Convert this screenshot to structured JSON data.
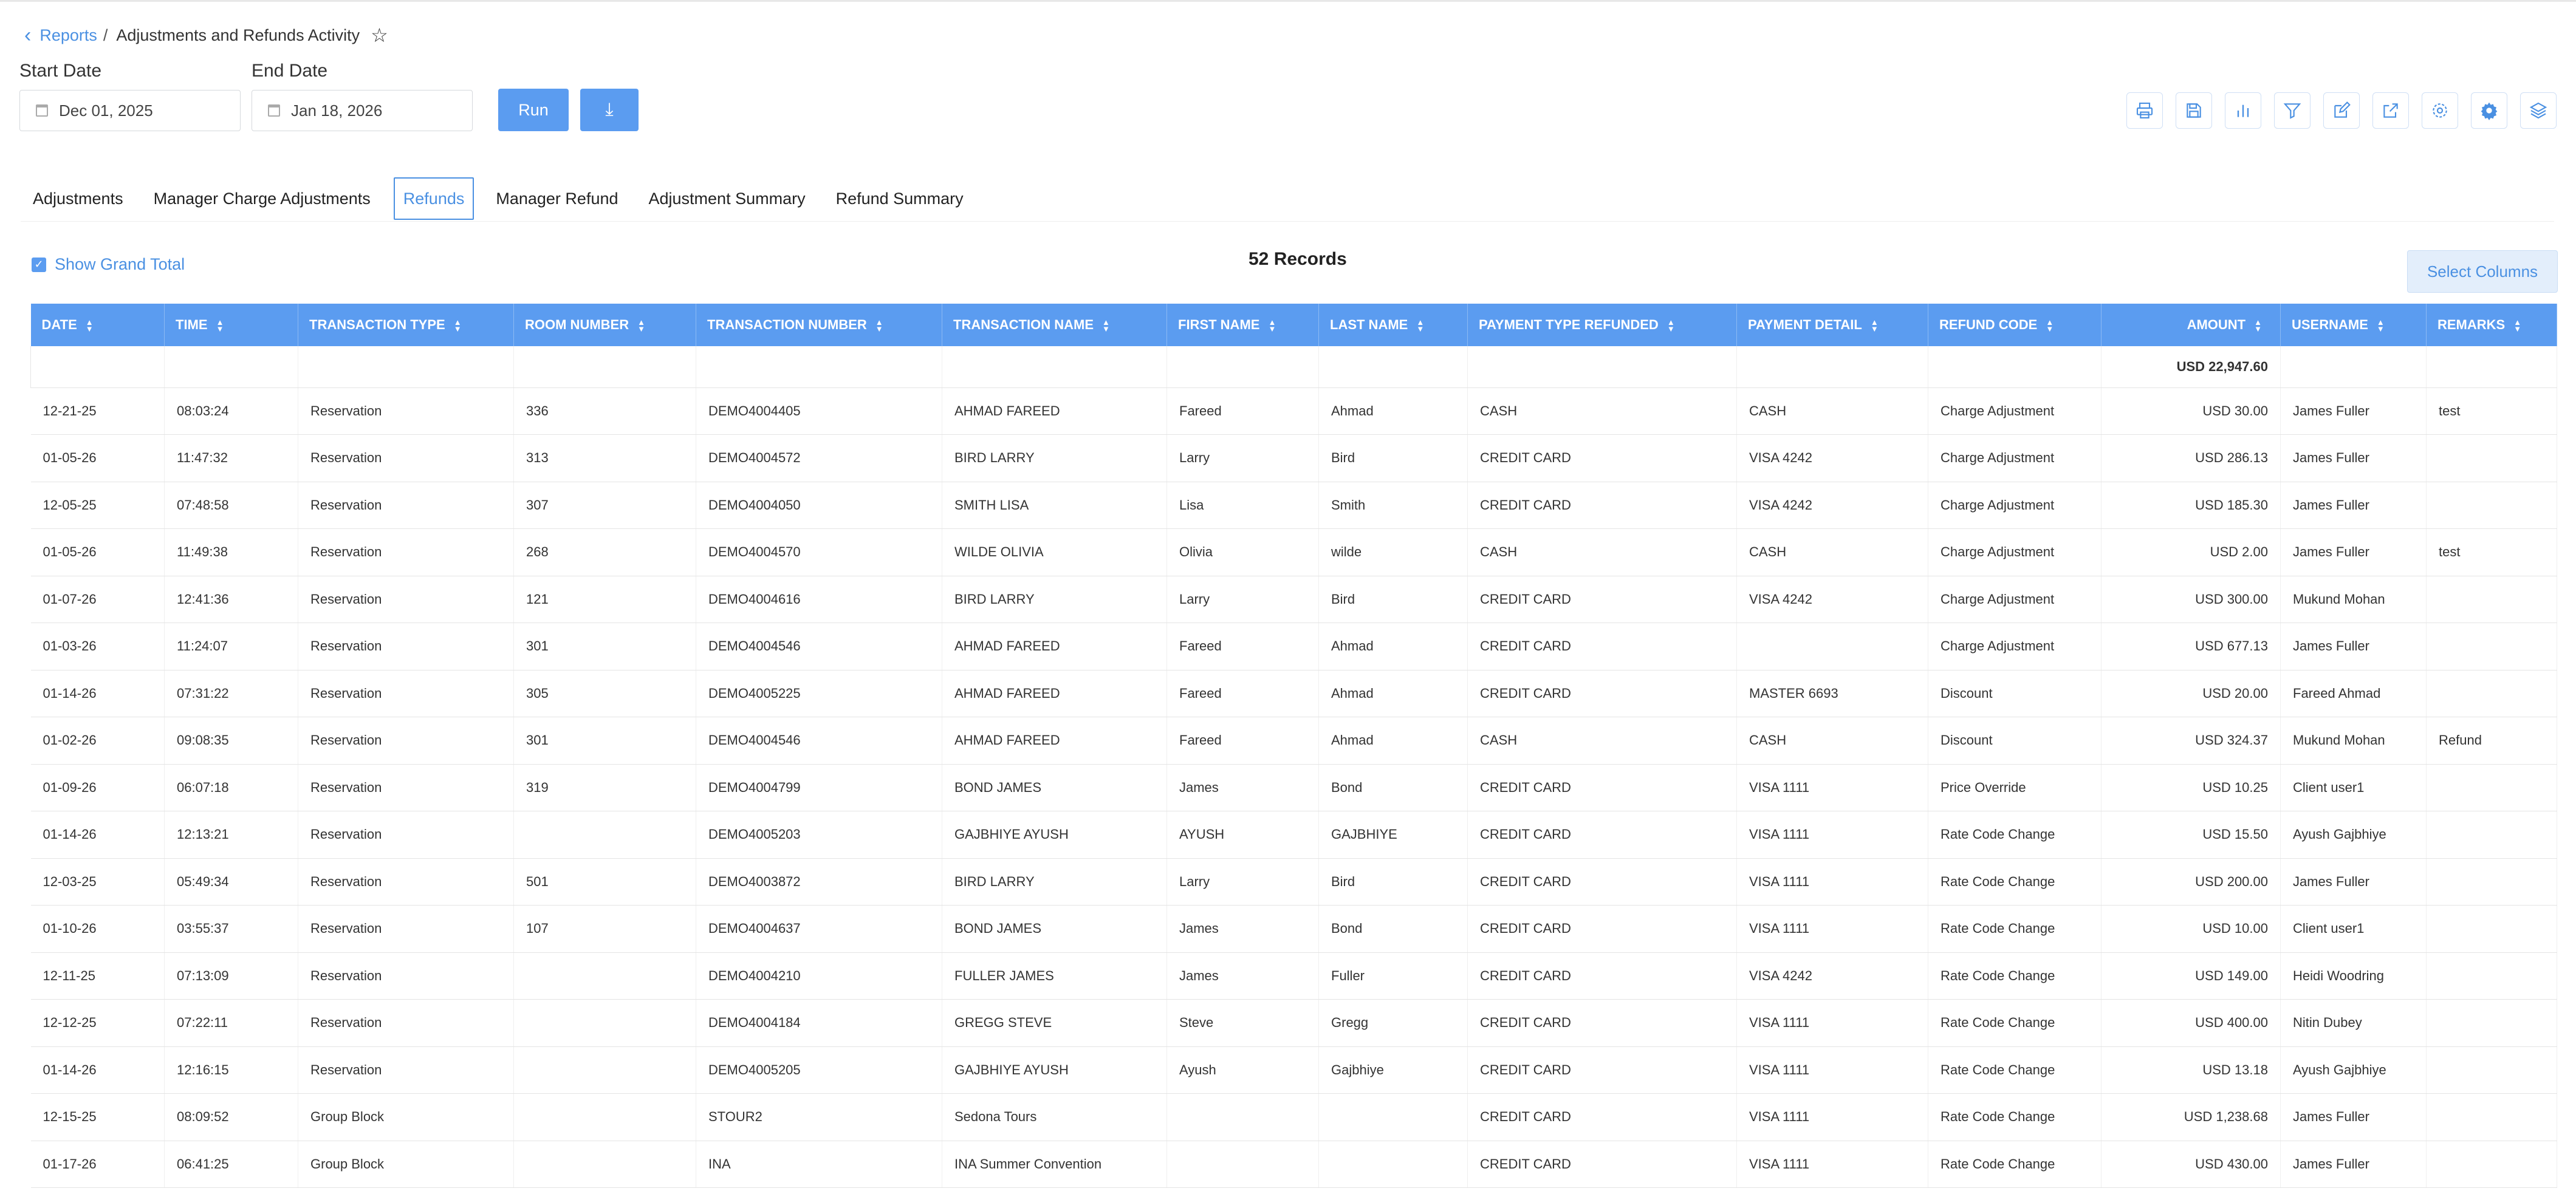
{
  "breadcrumb": {
    "parent": "Reports",
    "separator": "/",
    "current": "Adjustments and Refunds Activity"
  },
  "filters": {
    "start_label": "Start Date",
    "start_value": "Dec 01, 2025",
    "end_label": "End Date",
    "end_value": "Jan 18, 2026",
    "run_label": "Run"
  },
  "toolbar_icons": [
    "print-icon",
    "save-icon",
    "chart-icon",
    "filter-icon",
    "edit-icon",
    "export-icon",
    "settings-icon",
    "settings-alt-icon",
    "layers-icon"
  ],
  "tabs": [
    {
      "label": "Adjustments",
      "active": false
    },
    {
      "label": "Manager Charge Adjustments",
      "active": false
    },
    {
      "label": "Refunds",
      "active": true
    },
    {
      "label": "Manager Refund",
      "active": false
    },
    {
      "label": "Adjustment Summary",
      "active": false
    },
    {
      "label": "Refund Summary",
      "active": false
    }
  ],
  "show_grand_total_label": "Show Grand Total",
  "records_label": "52 Records",
  "select_columns_label": "Select Columns",
  "colors": {
    "accent": "#4a90e2",
    "header_bg": "#5b9cf0"
  },
  "table": {
    "columns": [
      "DATE",
      "TIME",
      "TRANSACTION TYPE",
      "ROOM NUMBER",
      "TRANSACTION NUMBER",
      "TRANSACTION NAME",
      "FIRST NAME",
      "LAST NAME",
      "PAYMENT TYPE REFUNDED",
      "PAYMENT DETAIL",
      "REFUND CODE",
      "AMOUNT",
      "USERNAME",
      "REMARKS"
    ],
    "grand_total": "USD 22,947.60",
    "rows": [
      [
        "12-21-25",
        "08:03:24",
        "Reservation",
        "336",
        "DEMO4004405",
        "AHMAD FAREED",
        "Fareed",
        "Ahmad",
        "CASH",
        "CASH",
        "Charge Adjustment",
        "USD 30.00",
        "James Fuller",
        "test"
      ],
      [
        "01-05-26",
        "11:47:32",
        "Reservation",
        "313",
        "DEMO4004572",
        "BIRD LARRY",
        "Larry",
        "Bird",
        "CREDIT CARD",
        "VISA 4242",
        "Charge Adjustment",
        "USD 286.13",
        "James Fuller",
        ""
      ],
      [
        "12-05-25",
        "07:48:58",
        "Reservation",
        "307",
        "DEMO4004050",
        "SMITH LISA",
        "Lisa",
        "Smith",
        "CREDIT CARD",
        "VISA 4242",
        "Charge Adjustment",
        "USD 185.30",
        "James Fuller",
        ""
      ],
      [
        "01-05-26",
        "11:49:38",
        "Reservation",
        "268",
        "DEMO4004570",
        "WILDE OLIVIA",
        "Olivia",
        "wilde",
        "CASH",
        "CASH",
        "Charge Adjustment",
        "USD 2.00",
        "James Fuller",
        "test"
      ],
      [
        "01-07-26",
        "12:41:36",
        "Reservation",
        "121",
        "DEMO4004616",
        "BIRD LARRY",
        "Larry",
        "Bird",
        "CREDIT CARD",
        "VISA 4242",
        "Charge Adjustment",
        "USD 300.00",
        "Mukund Mohan",
        ""
      ],
      [
        "01-03-26",
        "11:24:07",
        "Reservation",
        "301",
        "DEMO4004546",
        "AHMAD FAREED",
        "Fareed",
        "Ahmad",
        "CREDIT CARD",
        "",
        "Charge Adjustment",
        "USD 677.13",
        "James Fuller",
        ""
      ],
      [
        "01-14-26",
        "07:31:22",
        "Reservation",
        "305",
        "DEMO4005225",
        "AHMAD FAREED",
        "Fareed",
        "Ahmad",
        "CREDIT CARD",
        "MASTER 6693",
        "Discount",
        "USD 20.00",
        "Fareed Ahmad",
        ""
      ],
      [
        "01-02-26",
        "09:08:35",
        "Reservation",
        "301",
        "DEMO4004546",
        "AHMAD FAREED",
        "Fareed",
        "Ahmad",
        "CASH",
        "CASH",
        "Discount",
        "USD 324.37",
        "Mukund Mohan",
        "Refund"
      ],
      [
        "01-09-26",
        "06:07:18",
        "Reservation",
        "319",
        "DEMO4004799",
        "BOND JAMES",
        "James",
        "Bond",
        "CREDIT CARD",
        "VISA 1111",
        "Price Override",
        "USD 10.25",
        "Client user1",
        ""
      ],
      [
        "01-14-26",
        "12:13:21",
        "Reservation",
        "",
        "DEMO4005203",
        "GAJBHIYE AYUSH",
        "AYUSH",
        "GAJBHIYE",
        "CREDIT CARD",
        "VISA 1111",
        "Rate Code Change",
        "USD 15.50",
        "Ayush Gajbhiye",
        ""
      ],
      [
        "12-03-25",
        "05:49:34",
        "Reservation",
        "501",
        "DEMO4003872",
        "BIRD LARRY",
        "Larry",
        "Bird",
        "CREDIT CARD",
        "VISA 1111",
        "Rate Code Change",
        "USD 200.00",
        "James Fuller",
        ""
      ],
      [
        "01-10-26",
        "03:55:37",
        "Reservation",
        "107",
        "DEMO4004637",
        "BOND JAMES",
        "James",
        "Bond",
        "CREDIT CARD",
        "VISA 1111",
        "Rate Code Change",
        "USD 10.00",
        "Client user1",
        ""
      ],
      [
        "12-11-25",
        "07:13:09",
        "Reservation",
        "",
        "DEMO4004210",
        "FULLER JAMES",
        "James",
        "Fuller",
        "CREDIT CARD",
        "VISA 4242",
        "Rate Code Change",
        "USD 149.00",
        "Heidi Woodring",
        ""
      ],
      [
        "12-12-25",
        "07:22:11",
        "Reservation",
        "",
        "DEMO4004184",
        "GREGG STEVE",
        "Steve",
        "Gregg",
        "CREDIT CARD",
        "VISA 1111",
        "Rate Code Change",
        "USD 400.00",
        "Nitin Dubey",
        ""
      ],
      [
        "01-14-26",
        "12:16:15",
        "Reservation",
        "",
        "DEMO4005205",
        "GAJBHIYE AYUSH",
        "Ayush",
        "Gajbhiye",
        "CREDIT CARD",
        "VISA 1111",
        "Rate Code Change",
        "USD 13.18",
        "Ayush Gajbhiye",
        ""
      ],
      [
        "12-15-25",
        "08:09:52",
        "Group Block",
        "",
        "STOUR2",
        "Sedona Tours",
        "",
        "",
        "CREDIT CARD",
        "VISA 1111",
        "Rate Code Change",
        "USD 1,238.68",
        "James Fuller",
        ""
      ],
      [
        "01-17-26",
        "06:41:25",
        "Group Block",
        "",
        "INA",
        "INA Summer Convention",
        "",
        "",
        "CREDIT CARD",
        "VISA 1111",
        "Rate Code Change",
        "USD 430.00",
        "James Fuller",
        ""
      ]
    ]
  }
}
